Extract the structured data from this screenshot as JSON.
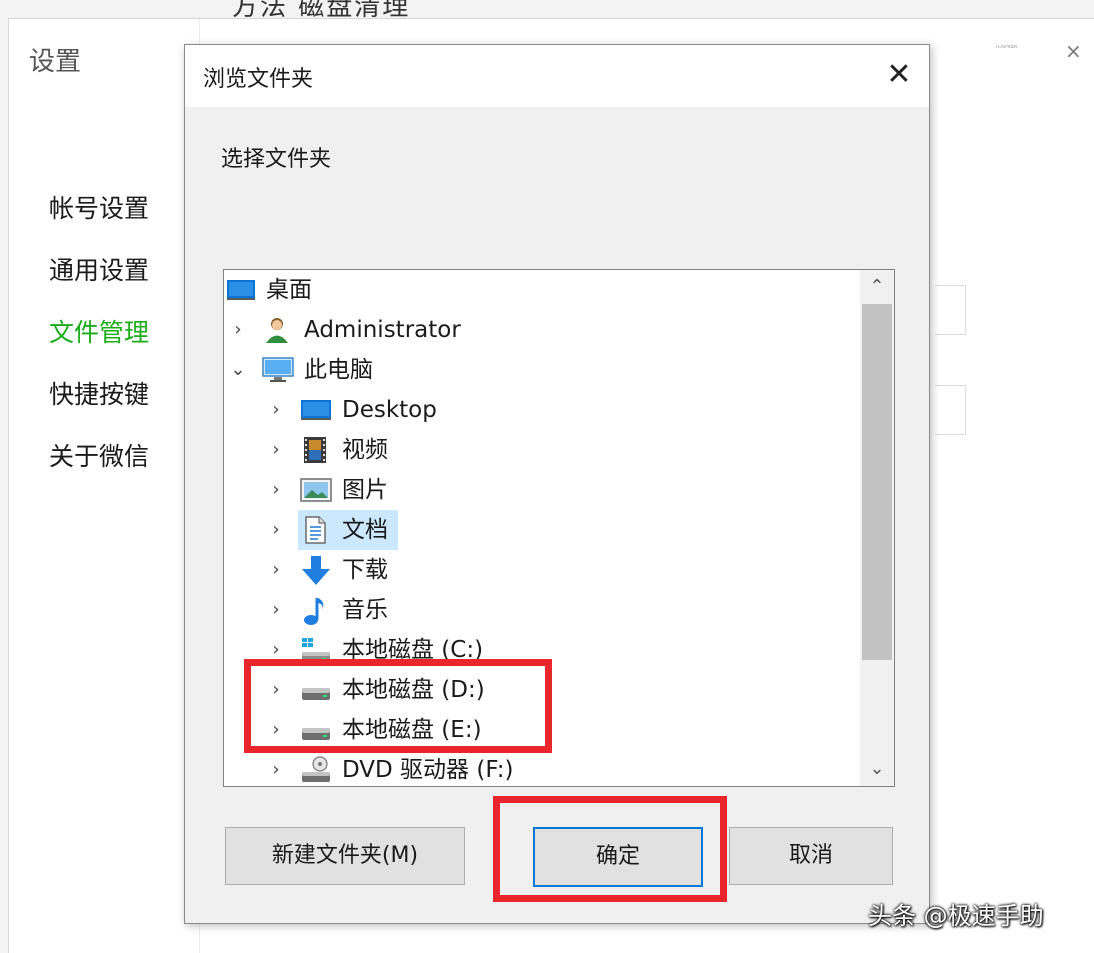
{
  "background": {
    "top_text": "方法 磁盘清理",
    "settings_title": "设置",
    "minimize_label": "TOSHIBA",
    "close_glyph": "×",
    "nav": [
      {
        "label": "帐号设置",
        "active": false
      },
      {
        "label": "通用设置",
        "active": false
      },
      {
        "label": "文件管理",
        "active": true
      },
      {
        "label": "快捷按键",
        "active": false
      },
      {
        "label": "关于微信",
        "active": false
      }
    ]
  },
  "dialog": {
    "title": "浏览文件夹",
    "close_glyph": "✕",
    "description": "选择文件夹",
    "tree": [
      {
        "label": "桌面",
        "icon": "desktop-icon",
        "level": 0,
        "chevron": ""
      },
      {
        "label": "Administrator",
        "icon": "user-icon",
        "level": 1,
        "chevron": "›"
      },
      {
        "label": "此电脑",
        "icon": "computer-icon",
        "level": 1,
        "chevron": "⌄"
      },
      {
        "label": "Desktop",
        "icon": "desktop-icon",
        "level": 2,
        "chevron": "›"
      },
      {
        "label": "视频",
        "icon": "video-icon",
        "level": 2,
        "chevron": "›"
      },
      {
        "label": "图片",
        "icon": "picture-icon",
        "level": 2,
        "chevron": "›"
      },
      {
        "label": "文档",
        "icon": "document-icon",
        "level": 2,
        "chevron": "›",
        "selected": true
      },
      {
        "label": "下载",
        "icon": "download-icon",
        "level": 2,
        "chevron": "›"
      },
      {
        "label": "音乐",
        "icon": "music-icon",
        "level": 2,
        "chevron": "›"
      },
      {
        "label": "本地磁盘 (C:)",
        "icon": "system-drive-icon",
        "level": 2,
        "chevron": "›"
      },
      {
        "label": "本地磁盘 (D:)",
        "icon": "drive-icon",
        "level": 2,
        "chevron": "›"
      },
      {
        "label": "本地磁盘 (E:)",
        "icon": "drive-icon",
        "level": 2,
        "chevron": "›"
      },
      {
        "label": "DVD 驱动器 (F:)",
        "icon": "dvd-drive-icon",
        "level": 2,
        "chevron": "›"
      }
    ],
    "buttons": {
      "new_folder": "新建文件夹(M)",
      "ok": "确定",
      "cancel": "取消"
    }
  },
  "watermark": "头条 @极速手助",
  "colors": {
    "accent_green": "#1aad19",
    "highlight_red": "#e8262b",
    "selection_blue": "#cce8ff",
    "focus_blue": "#0078d7"
  }
}
